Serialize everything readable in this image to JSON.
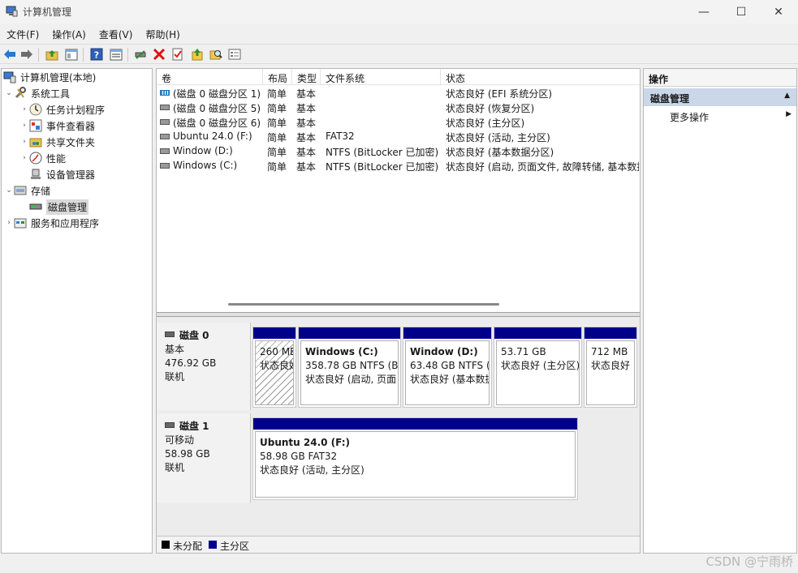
{
  "window": {
    "title": "计算机管理",
    "minimize": "—",
    "maximize": "☐",
    "close": "✕"
  },
  "menu": [
    "文件(F)",
    "操作(A)",
    "查看(V)",
    "帮助(H)"
  ],
  "tree": {
    "root": "计算机管理(本地)",
    "system_tools": "系统工具",
    "task_scheduler": "任务计划程序",
    "event_viewer": "事件查看器",
    "shared_folders": "共享文件夹",
    "performance": "性能",
    "device_manager": "设备管理器",
    "storage": "存储",
    "disk_management": "磁盘管理",
    "services_apps": "服务和应用程序"
  },
  "volumes": {
    "headers": [
      "卷",
      "布局",
      "类型",
      "文件系统",
      "状态"
    ],
    "rows": [
      {
        "name": "(磁盘 0 磁盘分区 1)",
        "layout": "简单",
        "type": "基本",
        "fs": "",
        "status": "状态良好 (EFI 系统分区)"
      },
      {
        "name": "(磁盘 0 磁盘分区 5)",
        "layout": "简单",
        "type": "基本",
        "fs": "",
        "status": "状态良好 (恢复分区)"
      },
      {
        "name": "(磁盘 0 磁盘分区 6)",
        "layout": "简单",
        "type": "基本",
        "fs": "",
        "status": "状态良好 (主分区)"
      },
      {
        "name": "Ubuntu 24.0 (F:)",
        "layout": "简单",
        "type": "基本",
        "fs": "FAT32",
        "status": "状态良好 (活动, 主分区)"
      },
      {
        "name": "Window (D:)",
        "layout": "简单",
        "type": "基本",
        "fs": "NTFS (BitLocker 已加密)",
        "status": "状态良好 (基本数据分区)"
      },
      {
        "name": "Windows (C:)",
        "layout": "简单",
        "type": "基本",
        "fs": "NTFS (BitLocker 已加密)",
        "status": "状态良好 (启动, 页面文件, 故障转储, 基本数据"
      }
    ]
  },
  "disks": [
    {
      "name": "磁盘 0",
      "kind": "基本",
      "size": "476.92 GB",
      "state": "联机",
      "partitions": [
        {
          "title": "",
          "line1": "260 MB",
          "line2": "状态良好"
        },
        {
          "title": "Windows  (C:)",
          "line1": "358.78 GB NTFS (Bi",
          "line2": "状态良好 (启动, 页面"
        },
        {
          "title": "Window  (D:)",
          "line1": "63.48 GB NTFS (",
          "line2": "状态良好 (基本数据"
        },
        {
          "title": "",
          "line1": "53.71 GB",
          "line2": "状态良好 (主分区)"
        },
        {
          "title": "",
          "line1": "712 MB",
          "line2": "状态良好"
        }
      ]
    },
    {
      "name": "磁盘 1",
      "kind": "可移动",
      "size": "58.98 GB",
      "state": "联机",
      "partitions": [
        {
          "title": "Ubuntu 24.0  (F:)",
          "line1": "58.98 GB FAT32",
          "line2": "状态良好 (活动, 主分区)"
        }
      ]
    }
  ],
  "legend": {
    "unallocated": "未分配",
    "primary": "主分区",
    "unallocated_color": "#000000",
    "primary_color": "#00008b"
  },
  "actions": {
    "title": "操作",
    "section": "磁盘管理",
    "more": "更多操作"
  },
  "watermark": "CSDN @宁雨桥"
}
